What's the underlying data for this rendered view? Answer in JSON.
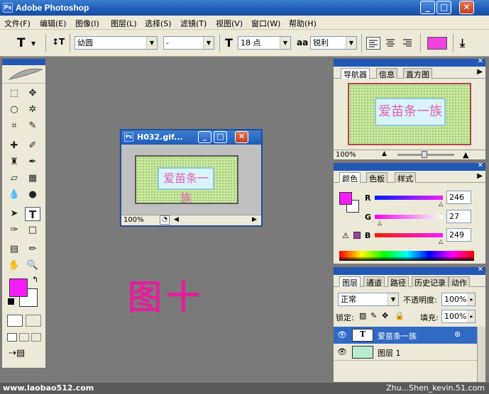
{
  "window": {
    "title": "Adobe Photoshop",
    "min": "_",
    "max": "□",
    "close": "✕"
  },
  "menu": [
    "文件(F)",
    "编辑(E)",
    "图像(I)",
    "图层(L)",
    "选择(S)",
    "滤镜(T)",
    "视图(V)",
    "窗口(W)",
    "帮助(H)"
  ],
  "options": {
    "tool_glyph": "T",
    "orient_glyph": "↕T",
    "font_family": "幼圆",
    "font_style": "-",
    "size_glyph": "T",
    "font_size": "18 点",
    "aa_label": "aa",
    "antialias": "锐利",
    "color_hex": "#f040e0",
    "warp_glyph": "⤓"
  },
  "document": {
    "title": "H032.gif...",
    "zoom": "100%",
    "banner_text": "爱苗条一族",
    "min": "_",
    "max": "□",
    "close": "✕"
  },
  "canvas_text": "图十",
  "navigator": {
    "tabs": [
      "导航器",
      "信息",
      "直方图"
    ],
    "zoom": "100%",
    "banner_text": "爱苗条一族"
  },
  "color_panel": {
    "tabs": [
      "颜色",
      "色板",
      "样式"
    ],
    "r_label": "R",
    "g_label": "G",
    "b_label": "B",
    "r": "246",
    "g": "27",
    "b": "249",
    "fg_hex": "#f61bf9"
  },
  "layers": {
    "tabs": [
      "图层",
      "通道",
      "路径",
      "历史记录",
      "动作"
    ],
    "blend_mode": "正常",
    "opacity_label": "不透明度:",
    "opacity": "100%",
    "lock_label": "锁定:",
    "fill_label": "填充:",
    "fill": "100%",
    "items": [
      {
        "name": "爱苗条一族",
        "type": "T"
      },
      {
        "name": "图层 1",
        "type": ""
      }
    ]
  },
  "watermark_left": "www.laobao512.com",
  "watermark_right": "Zhu...Shen_kevin.51.com"
}
